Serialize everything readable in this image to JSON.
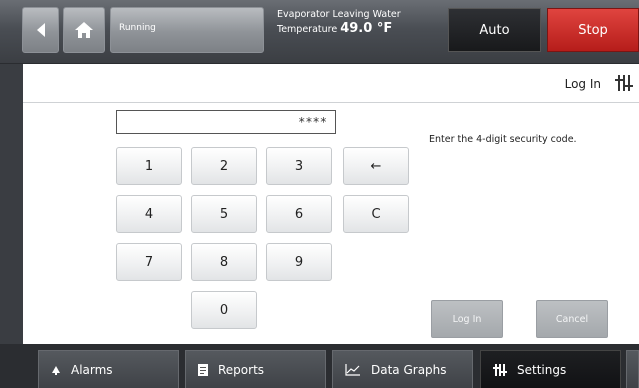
{
  "header": {
    "status_text": "Running",
    "evap_label_line1": "Evaporator Leaving Water",
    "evap_label_line2": "Temperature",
    "evap_value": "49.0 °F",
    "mode_label": "Auto",
    "stop_label": "Stop"
  },
  "login": {
    "title": "Log In",
    "code_value": "****",
    "hint": "Enter the 4-digit security code.",
    "keys": [
      "1",
      "2",
      "3",
      "←",
      "4",
      "5",
      "6",
      "C",
      "7",
      "8",
      "9",
      "0"
    ],
    "login_button": "Log In",
    "cancel_button": "Cancel"
  },
  "tabs": {
    "alarms": "Alarms",
    "reports": "Reports",
    "data_graphs": "Data Graphs",
    "settings": "Settings"
  },
  "colors": {
    "stop": "#c9302c",
    "active_tab": "#151618"
  }
}
